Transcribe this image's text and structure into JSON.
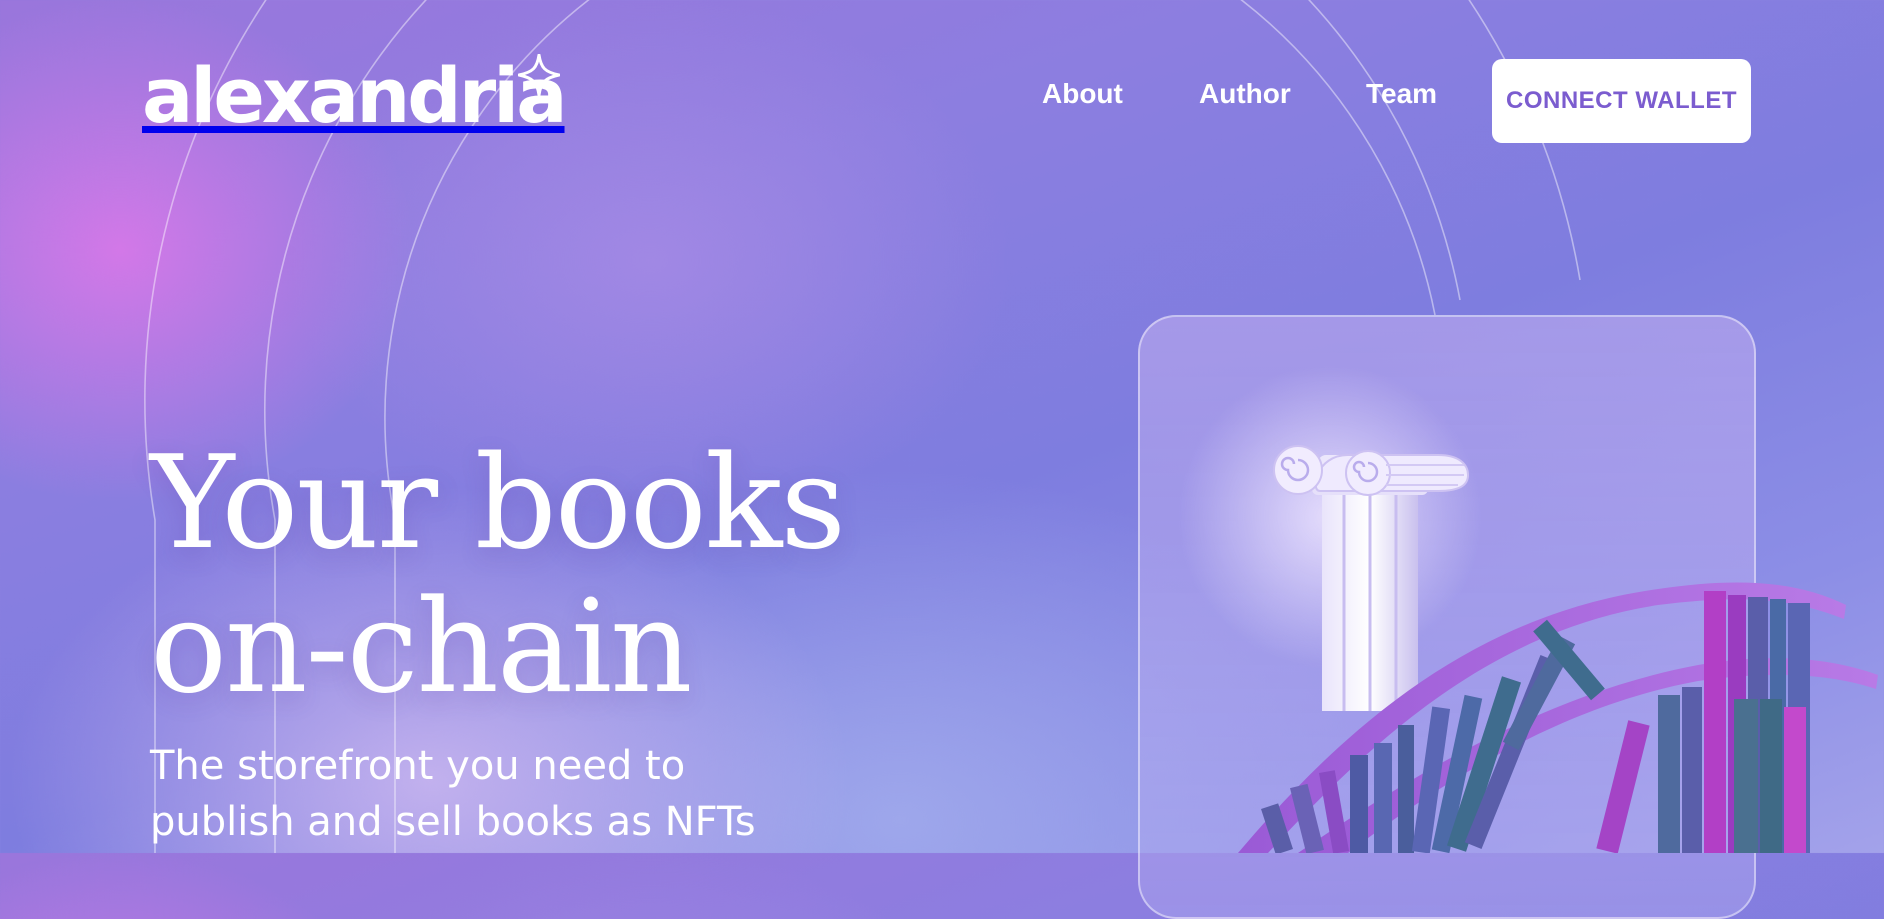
{
  "brand": {
    "name": "alexandria",
    "icon": "sparkle-star-icon"
  },
  "nav": {
    "links": [
      {
        "label": "About"
      },
      {
        "label": "Author"
      },
      {
        "label": "Team"
      }
    ],
    "cta_label": "CONNECT WALLET"
  },
  "hero": {
    "title_line1": "Your books",
    "title_line2": "on-chain",
    "subtitle_line1": "The storefront you need to",
    "subtitle_line2": "publish and sell books as NFTs"
  },
  "illustration": {
    "icons": [
      "ionic-column-icon",
      "book-helix-icon"
    ]
  },
  "colors": {
    "accent": "#7b5ccf",
    "background_pink": "#d678e8",
    "background_violet": "#8c7ee0",
    "text": "#ffffff"
  }
}
